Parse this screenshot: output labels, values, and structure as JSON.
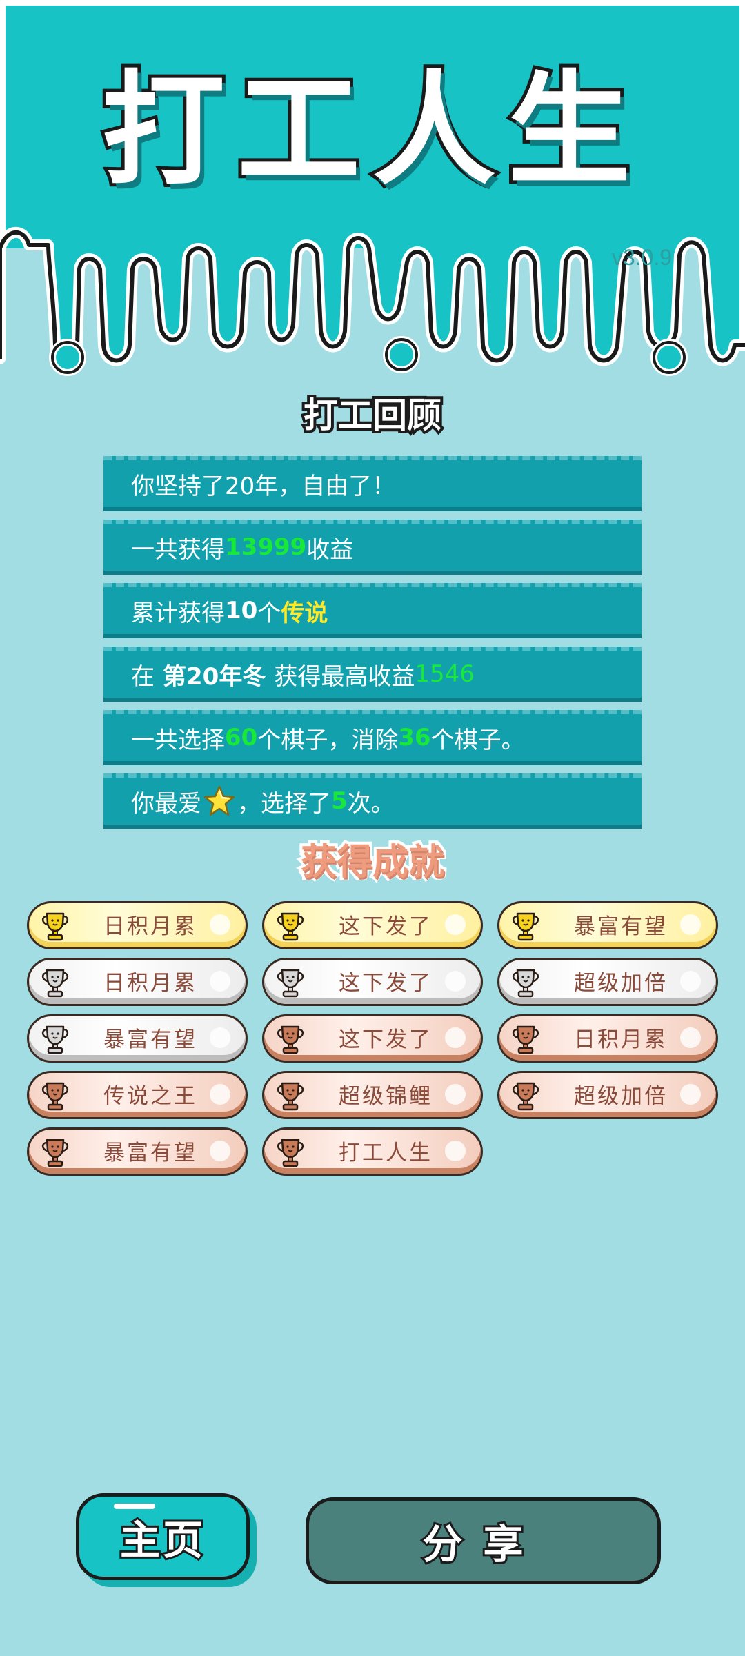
{
  "header": {
    "game_title": "打工人生",
    "version": "v3.0.9"
  },
  "review": {
    "title": "打工回顾",
    "rows": [
      {
        "parts": [
          {
            "text": "你坚持了20年，自由了！",
            "style": "plain"
          }
        ]
      },
      {
        "parts": [
          {
            "text": "一共获得",
            "style": "plain"
          },
          {
            "text": "13999",
            "style": "green"
          },
          {
            "text": "收益",
            "style": "plain"
          }
        ]
      },
      {
        "parts": [
          {
            "text": "累计获得",
            "style": "plain"
          },
          {
            "text": "10",
            "style": "bold"
          },
          {
            "text": "个",
            "style": "plain"
          },
          {
            "text": "传说",
            "style": "yellow"
          }
        ]
      },
      {
        "parts": [
          {
            "text": "在",
            "style": "plain"
          },
          {
            "text": "第20年冬",
            "style": "white-bold"
          },
          {
            "text": "获得最高收益",
            "style": "plain"
          },
          {
            "text": "1546",
            "style": "green-thin"
          }
        ]
      },
      {
        "parts": [
          {
            "text": "一共选择",
            "style": "plain"
          },
          {
            "text": "60",
            "style": "green"
          },
          {
            "text": "个棋子，消除",
            "style": "plain"
          },
          {
            "text": "36",
            "style": "green"
          },
          {
            "text": "个棋子。",
            "style": "plain"
          }
        ]
      },
      {
        "parts": [
          {
            "text": "你最爱",
            "style": "plain"
          },
          {
            "text": "",
            "style": "star"
          },
          {
            "text": "，选择了",
            "style": "plain"
          },
          {
            "text": "5",
            "style": "green"
          },
          {
            "text": "次。",
            "style": "plain"
          }
        ]
      }
    ]
  },
  "achievements": {
    "title": "获得成就",
    "badges": [
      {
        "label": "日积月累",
        "tier": "gold"
      },
      {
        "label": "这下发了",
        "tier": "gold"
      },
      {
        "label": "暴富有望",
        "tier": "gold"
      },
      {
        "label": "日积月累",
        "tier": "silver"
      },
      {
        "label": "这下发了",
        "tier": "silver"
      },
      {
        "label": "超级加倍",
        "tier": "silver"
      },
      {
        "label": "暴富有望",
        "tier": "silver"
      },
      {
        "label": "这下发了",
        "tier": "bronze"
      },
      {
        "label": "日积月累",
        "tier": "bronze"
      },
      {
        "label": "传说之王",
        "tier": "bronze"
      },
      {
        "label": "超级锦鲤",
        "tier": "bronze"
      },
      {
        "label": "超级加倍",
        "tier": "bronze"
      },
      {
        "label": "暴富有望",
        "tier": "bronze"
      },
      {
        "label": "打工人生",
        "tier": "bronze"
      }
    ]
  },
  "buttons": {
    "home": "主页",
    "share": "分享"
  },
  "colors": {
    "background": "#a3dde4",
    "header_teal": "#17c3c4",
    "row_teal": "#13a0ad",
    "gold_trophy": "#f6d21c",
    "silver_trophy": "#d8d8d8",
    "bronze_trophy": "#c97a59"
  },
  "icons": {
    "trophy": "trophy-icon",
    "favorite_piece": "star-icon"
  }
}
